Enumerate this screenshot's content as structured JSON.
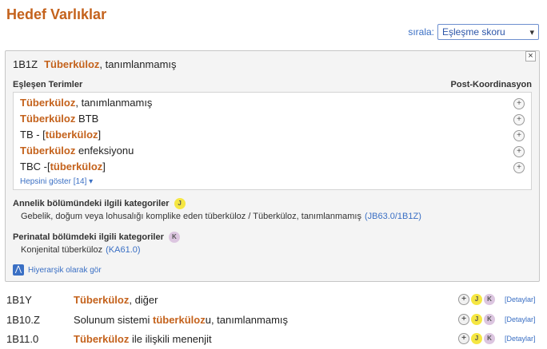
{
  "page": {
    "title": "Hedef Varlıklar"
  },
  "sort": {
    "label": "sırala:",
    "selected": "Eşleşme skoru"
  },
  "card": {
    "close": "×",
    "code": "1B1Z",
    "title_hl": "Tüberküloz",
    "title_rest": ", tanımlanmamış",
    "matched_label": "Eşleşen Terimler",
    "postcoord_label": "Post-Koordinasyon",
    "terms": [
      {
        "pre": "",
        "hl": "Tüberküloz",
        "post": ", tanımlanmamış"
      },
      {
        "pre": "",
        "hl": "Tüberküloz",
        "post": " BTB"
      },
      {
        "pre": "TB - [",
        "hl": "tüberküloz",
        "post": "]"
      },
      {
        "pre": "",
        "hl": "Tüberküloz",
        "post": " enfeksiyonu"
      },
      {
        "pre": "TBC -[",
        "hl": "tüberküloz",
        "post": "]"
      }
    ],
    "show_all": "Hepsini göster [14] ▾",
    "maternity": {
      "title": "Annelik bölümündeki ilgili kategoriler",
      "badge": "J",
      "text": "Gebelik, doğum veya lohusalığı komplike eden tüberküloz / Tüberküloz, tanımlanmamış",
      "link": "(JB63.0/1B1Z)"
    },
    "perinatal": {
      "title": "Perinatal bölümdeki ilgili kategoriler",
      "badge": "K",
      "text": "Konjenital tüberküloz",
      "link": "(KA61.0)"
    },
    "hierarchy": "Hiyerarşik olarak gör"
  },
  "results": [
    {
      "code": "1B1Y",
      "hl": "Tüberküloz",
      "pre": "",
      "post": ", diğer",
      "badges": [
        "+",
        "J",
        "K"
      ],
      "details": "[Detaylar]"
    },
    {
      "code": "1B10.Z",
      "pre": "Solunum sistemi ",
      "hl": "tüberküloz",
      "post": "u, tanımlanmamış",
      "badges": [
        "+",
        "J",
        "K"
      ],
      "details": "[Detaylar]"
    },
    {
      "code": "1B11.0",
      "pre": "",
      "hl": "Tüberküloz",
      "post": " ile ilişkili menenjit",
      "badges": [
        "+",
        "J",
        "K"
      ],
      "details": "[Detaylar]"
    }
  ]
}
